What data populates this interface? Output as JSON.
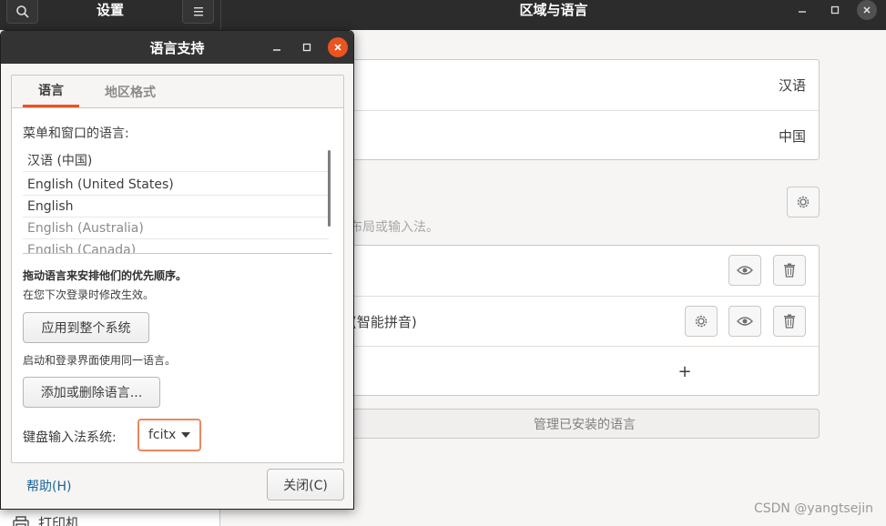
{
  "settings_window": {
    "sidebar_title": "设置",
    "window_title": "区域与语言",
    "sidebar_bottom_item": "打印机"
  },
  "region_panel": {
    "language_value": "汉语",
    "formats_value": "中国",
    "input_hint": "布局或输入法。",
    "input_source_2_label": "(智能拼音)",
    "add_symbol": "+",
    "manage_label": "管理已安装的语言"
  },
  "dialog": {
    "title": "语言支持",
    "tabs": [
      {
        "label": "语言"
      },
      {
        "label": "地区格式"
      }
    ],
    "menus_label": "菜单和窗口的语言:",
    "languages": [
      {
        "label": "汉语 (中国)"
      },
      {
        "label": "English (United States)"
      },
      {
        "label": "English"
      },
      {
        "label": "English (Australia)"
      },
      {
        "label": "English (Canada)"
      }
    ],
    "drag_hint": "拖动语言来安排他们的优先顺序。",
    "relogin_hint": "在您下次登录时修改生效。",
    "apply_button": "应用到整个系统",
    "login_hint": "启动和登录界面使用同一语言。",
    "add_remove_button": "添加或删除语言...",
    "input_system_label": "键盘输入法系统:",
    "input_system_value": "fcitx",
    "help_link": "帮助(H)",
    "close_button": "关闭(C)"
  },
  "watermark": "CSDN @yangtsejin",
  "colors": {
    "accent": "#e95420",
    "header_bg": "#2c2c2c",
    "link": "#19649a"
  }
}
